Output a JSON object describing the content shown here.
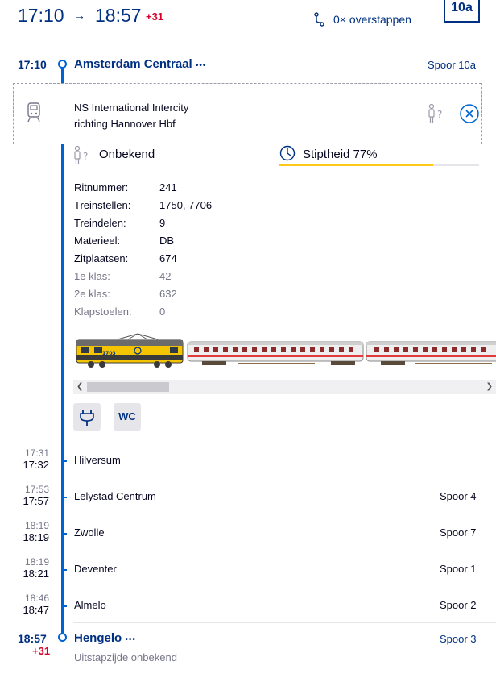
{
  "header": {
    "departure": "17:10",
    "arrow": "→",
    "arrival": "18:57",
    "arrival_delay": "+31",
    "transfers": "0× overstappen",
    "platform_badge": "10a"
  },
  "origin": {
    "time": "17:10",
    "name": "Amsterdam Centraal",
    "more": "•••",
    "platform": "Spoor 10a"
  },
  "train": {
    "line1": "NS International Intercity",
    "line2": "richting Hannover Hbf",
    "crowd_label": "Onbekend",
    "punctuality": "Stiptheid 77%",
    "punctuality_value": 77,
    "details": [
      {
        "label": "Ritnummer:",
        "value": "241"
      },
      {
        "label": "Treinstellen:",
        "value": "1750, 7706"
      },
      {
        "label": "Treindelen:",
        "value": "9"
      },
      {
        "label": "Materieel:",
        "value": "DB"
      },
      {
        "label": "Zitplaatsen:",
        "value": "674"
      },
      {
        "label": "1e klas:",
        "value": "42"
      },
      {
        "label": "2e klas:",
        "value": "632"
      },
      {
        "label": "Klapstoelen:",
        "value": "0"
      }
    ],
    "loco_number": "1703",
    "facilities": {
      "power": "power-socket",
      "wc": "WC"
    }
  },
  "stops": [
    {
      "planned": "17:31",
      "actual": "17:32",
      "name": "Hilversum",
      "platform": ""
    },
    {
      "planned": "17:53",
      "actual": "17:57",
      "name": "Lelystad Centrum",
      "platform": "Spoor 4"
    },
    {
      "planned": "18:19",
      "actual": "18:19",
      "name": "Zwolle",
      "platform": "Spoor 7"
    },
    {
      "planned": "18:19",
      "actual": "18:21",
      "name": "Deventer",
      "platform": "Spoor 1"
    },
    {
      "planned": "18:46",
      "actual": "18:47",
      "name": "Almelo",
      "platform": "Spoor 2"
    }
  ],
  "destination": {
    "time": "18:57",
    "delay": "+31",
    "name": "Hengelo",
    "more": "•••",
    "platform": "Spoor 3",
    "note": "Uitstapzijde onbekend"
  },
  "colors": {
    "navy": "#003082",
    "blue": "#0063d3",
    "red": "#db0029",
    "yellow": "#ffc917"
  }
}
